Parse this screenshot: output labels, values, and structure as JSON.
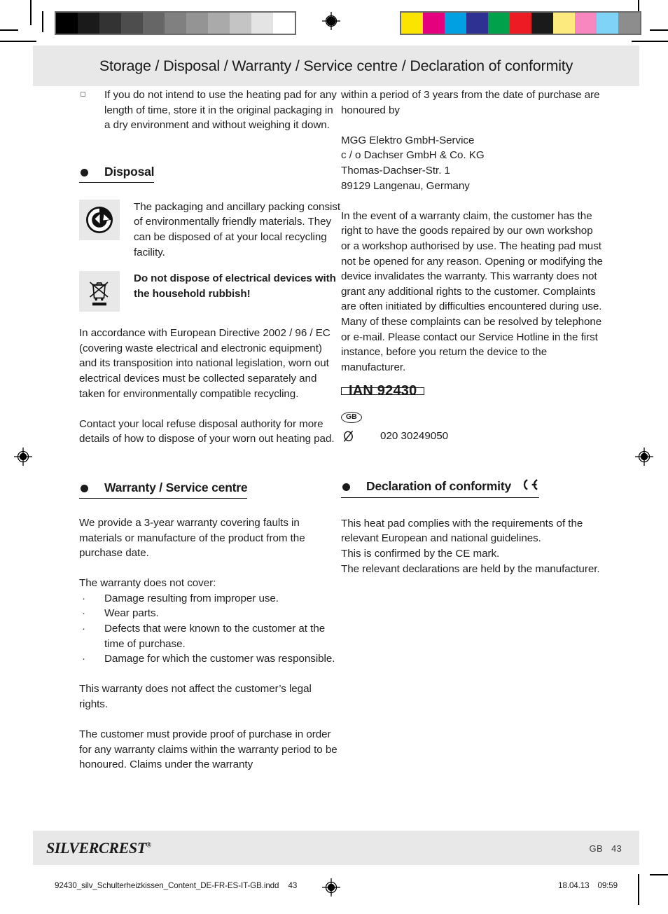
{
  "header": {
    "title": "Storage / Disposal / Warranty / Service centre / Declaration of conformity"
  },
  "left_column": {
    "storage_item": "If you do not intend to use the heating pad for any length of time, store it in the original packaging in a dry environment and without weighing it down.",
    "disposal_heading": "Disposal",
    "packaging_text": "The packaging and ancillary packing consist of environmentally friendly materials. They can be disposed of at your local recycling facility.",
    "weee_text": "Do not dispose of electrical devices with the household rubbish!",
    "directive_paragraph": "In accordance with European Directive 2002 / 96 / EC (covering waste electrical and electronic equipment) and its transposition into national legislation, worn out electrical devices must be collected separately and taken for environmentally compatible recycling.",
    "contact_paragraph": "Contact your local refuse disposal authority for more details of how to dispose of your worn out heating pad.",
    "warranty_heading": "Warranty / Service centre",
    "warranty_intro": "We provide a 3-year warranty covering faults in materials or manufacture of the product from the purchase date.",
    "exclusions_label": "The warranty does not cover:",
    "exclusions": [
      "Damage resulting from improper use.",
      "Wear parts.",
      "Defects that were known to the customer at the time of purchase.",
      "Damage for which the customer was responsible."
    ],
    "legal_rights_paragraph": "This warranty does not affect the customer’s legal rights.",
    "proof_paragraph": "The customer must provide proof of purchase in order for any warranty claims within the warranty period to be honoured. Claims under the warranty"
  },
  "right_column": {
    "continuation_paragraph": "within a period of 3 years from the date of purchase are honoured by",
    "address": [
      "MGG Elektro GmbH-Service",
      "c / o Dachser GmbH & Co. KG",
      "Thomas-Dachser-Str. 1",
      "89129 Langenau, Germany"
    ],
    "claim_paragraph": "In the event of a warranty claim, the customer has the right to have the goods repaired by our own workshop or a workshop authorised by use. The heating pad must not be opened for any reason. Opening or modifying the device invalidates the warranty. This warranty does not grant any additional rights to the customer. Complaints are often initiated by difficulties encountered during use. Many of these complaints can be resolved by telephone or e-mail. Please contact our Service Hotline in the first instance, before you return the device to the manufacturer.",
    "ian_label": "IAN 92430",
    "country_code": "GB",
    "phone_number": "020 30249050",
    "conformity_heading": "Declaration of conformity",
    "conformity_lines": [
      "This heat pad complies with the requirements of the relevant European and national guidelines.",
      "This is confirmed by the CE mark.",
      "The relevant declarations are held by the manufacturer."
    ]
  },
  "footer": {
    "brand_silver": "SILVER",
    "brand_crest": "CREST",
    "brand_registered": "®",
    "page_country": "GB",
    "page_number": "43",
    "print_filename": "92430_silv_Schulterheizkissen_Content_DE-FR-ES-IT-GB.indd",
    "print_page": "43",
    "print_date": "18.04.13",
    "print_time": "09:59"
  },
  "colors": {
    "band_grey": "#e8e8e8",
    "text": "#1a1a1a",
    "grayscale_bar": [
      "#000000",
      "#1a1a1a",
      "#333333",
      "#4d4d4d",
      "#666666",
      "#808080",
      "#949494",
      "#aaaaaa",
      "#c4c4c4",
      "#e4e4e4",
      "#ffffff"
    ],
    "color_bar": [
      "#fbe400",
      "#e5007d",
      "#00a0e3",
      "#2e3192",
      "#00a14b",
      "#ed1c24",
      "#1a1a1a",
      "#fdea7e",
      "#f887c0",
      "#7ed3f7",
      "#8d8d8d"
    ]
  }
}
